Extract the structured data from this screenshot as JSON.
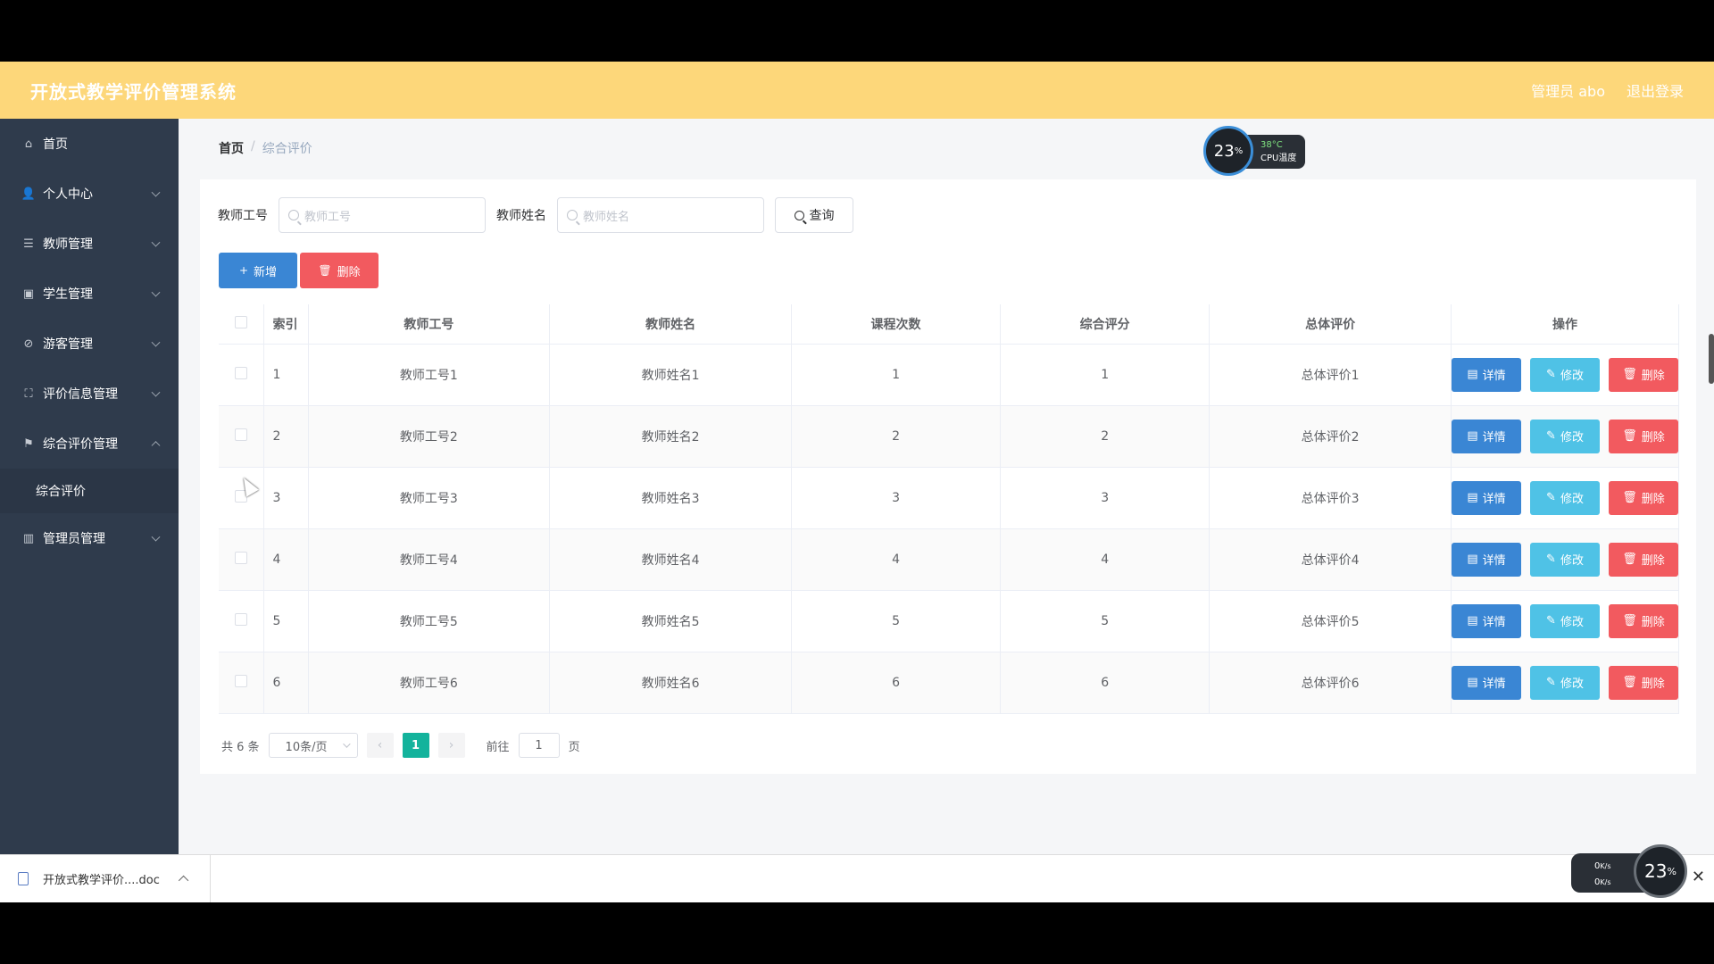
{
  "header": {
    "title": "开放式教学评价管理系统",
    "user": "管理员 abo",
    "logout": "退出登录"
  },
  "sidebar": {
    "items": [
      {
        "label": "首页",
        "icon": "home-icon",
        "glyph": "⌂"
      },
      {
        "label": "个人中心",
        "icon": "user-icon",
        "glyph": "👤"
      },
      {
        "label": "教师管理",
        "icon": "list-icon",
        "glyph": "☰"
      },
      {
        "label": "学生管理",
        "icon": "clipboard-icon",
        "glyph": "▣"
      },
      {
        "label": "游客管理",
        "icon": "edit-off-icon",
        "glyph": "⊘"
      },
      {
        "label": "评价信息管理",
        "icon": "fullscreen-icon",
        "glyph": "⛶"
      },
      {
        "label": "综合评价管理",
        "icon": "flag-icon",
        "glyph": "⚑"
      },
      {
        "label": "管理员管理",
        "icon": "chart-icon",
        "glyph": "▥"
      }
    ],
    "subitem": "综合评价"
  },
  "breadcrumb": {
    "home": "首页",
    "separator": "/",
    "current": "综合评价"
  },
  "cpu": {
    "percent": "23",
    "unit": "%",
    "temp": "38°C",
    "label": "CPU温度"
  },
  "search": {
    "label1": "教师工号",
    "placeholder1": "教师工号",
    "label2": "教师姓名",
    "placeholder2": "教师姓名",
    "query": "查询"
  },
  "actions": {
    "add": "新增",
    "delete": "删除"
  },
  "table": {
    "headers": [
      "索引",
      "教师工号",
      "教师姓名",
      "课程次数",
      "综合评分",
      "总体评价",
      "操作"
    ],
    "rows": [
      [
        "1",
        "教师工号1",
        "教师姓名1",
        "1",
        "1",
        "总体评价1"
      ],
      [
        "2",
        "教师工号2",
        "教师姓名2",
        "2",
        "2",
        "总体评价2"
      ],
      [
        "3",
        "教师工号3",
        "教师姓名3",
        "3",
        "3",
        "总体评价3"
      ],
      [
        "4",
        "教师工号4",
        "教师姓名4",
        "4",
        "4",
        "总体评价4"
      ],
      [
        "5",
        "教师工号5",
        "教师姓名5",
        "5",
        "5",
        "总体评价5"
      ],
      [
        "6",
        "教师工号6",
        "教师姓名6",
        "6",
        "6",
        "总体评价6"
      ]
    ],
    "op_detail": "详情",
    "op_edit": "修改",
    "op_delete": "删除"
  },
  "pagination": {
    "total": "共 6 条",
    "page_size": "10条/页",
    "current": "1",
    "goto_prefix": "前往",
    "goto_value": "1",
    "goto_suffix": "页"
  },
  "download": {
    "filename": "开放式教学评价....doc"
  },
  "net": {
    "up": "0",
    "down": "0",
    "rate_unit": "K/s",
    "percent": "23",
    "unit": "%"
  },
  "colors": {
    "header": "#fdd77a",
    "sidebar": "#2f3b4c",
    "primary": "#3a86d4",
    "danger": "#f25a5f",
    "info": "#4fc2e6",
    "active_page": "#13b39c"
  }
}
